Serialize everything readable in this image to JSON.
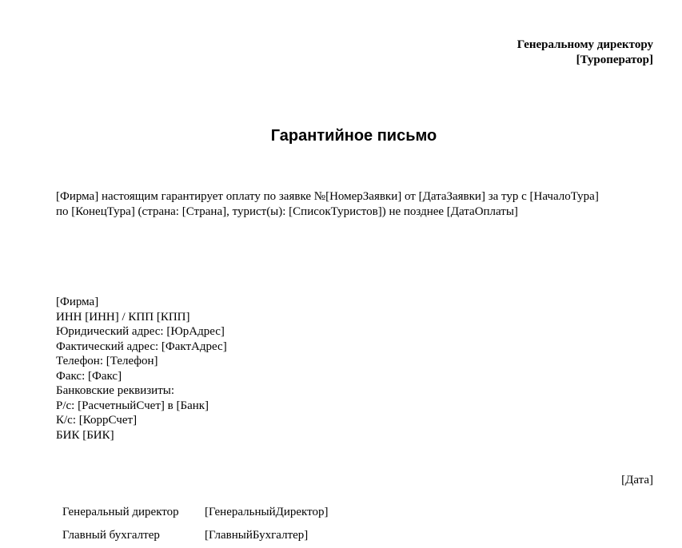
{
  "addressee": {
    "line1": "Генеральному директору",
    "line2": "[Туроператор]"
  },
  "title": "Гарантийное письмо",
  "body": {
    "line1": "[Фирма] настоящим гарантирует оплату по заявке №[НомерЗаявки] от [ДатаЗаявки] за тур с [НачалоТура]",
    "line2": "по [КонецТура] (страна: [Страна], турист(ы): [СписокТуристов]) не позднее [ДатаОплаты]"
  },
  "requisites": {
    "firm": "[Фирма]",
    "inn_kpp": "ИНН  [ИНН] / КПП  [КПП]",
    "legal_address": "Юридический адрес: [ЮрАдрес]",
    "actual_address": "Фактический адрес: [ФактАдрес]",
    "phone": "Телефон: [Телефон]",
    "fax": "Факс: [Факс]",
    "bank_details": "Банковские реквизиты:",
    "account": "Р/с: [РасчетныйСчет] в [Банк]",
    "corr_account": "К/с: [КоррСчет]",
    "bik": "БИК [БИК]"
  },
  "date": "[Дата]",
  "signatures": [
    {
      "role": "Генеральный директор",
      "name": "[ГенеральныйДиректор]"
    },
    {
      "role": "Главный бухгалтер",
      "name": "[ГлавныйБухгалтер]"
    }
  ]
}
